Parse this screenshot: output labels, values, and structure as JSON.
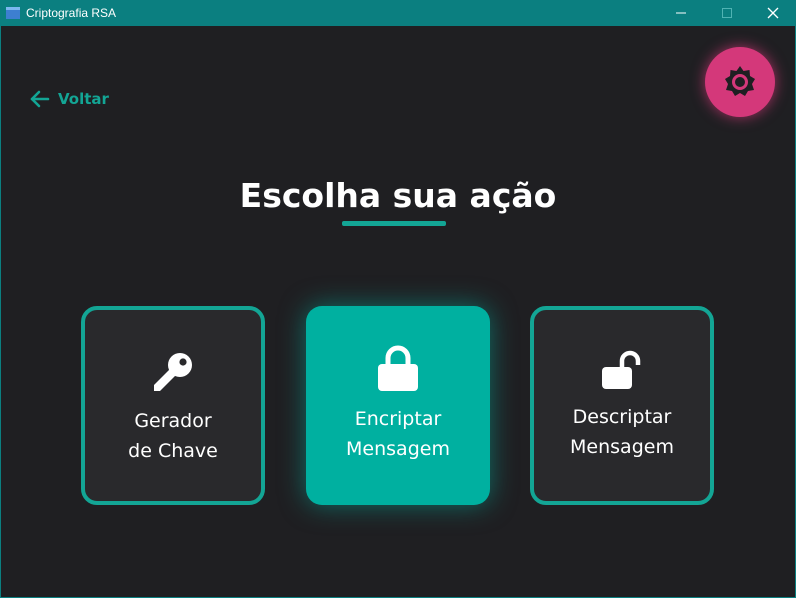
{
  "window": {
    "title": "Criptografia RSA",
    "controls": [
      "minimize",
      "maximize",
      "close"
    ]
  },
  "back": {
    "label": "Voltar",
    "icon": "arrow-left-icon"
  },
  "theme_toggle": {
    "icon": "sun-icon",
    "color": "#d4387a"
  },
  "heading": {
    "title": "Escolha sua ação",
    "accent": "#13a595"
  },
  "actions": [
    {
      "line1": "Gerador",
      "line2": "de Chave",
      "icon": "key-icon",
      "selected": false
    },
    {
      "line1": "Encriptar",
      "line2": "Mensagem",
      "icon": "lock-icon",
      "selected": true
    },
    {
      "line1": "Descriptar",
      "line2": "Mensagem",
      "icon": "unlock-icon",
      "selected": false
    }
  ],
  "colors": {
    "titlebar": "#0b7f80",
    "background": "#1f1f22",
    "card": "#29292c",
    "accent": "#13a595",
    "active_card": "#00b0a0"
  }
}
